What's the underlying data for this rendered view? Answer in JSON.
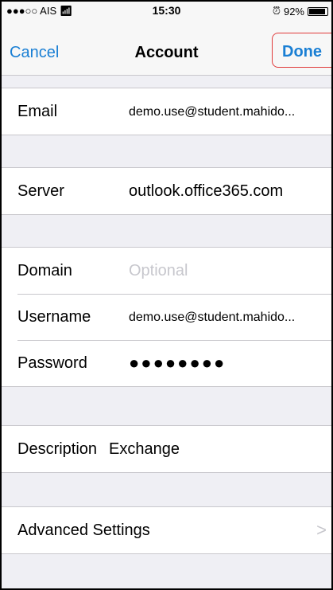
{
  "status_bar": {
    "carrier": "●●●○○ AIS",
    "wifi_icon": "wifi-icon",
    "time": "15:30",
    "alarm_icon": "alarm-icon",
    "battery_percent": "92%",
    "battery_level": 0.92
  },
  "nav": {
    "cancel_label": "Cancel",
    "title": "Account",
    "done_label": "Done"
  },
  "fields": {
    "email": {
      "label": "Email",
      "value": "demo.use@student.mahido..."
    },
    "server": {
      "label": "Server",
      "value": "outlook.office365.com"
    },
    "domain": {
      "label": "Domain",
      "placeholder": "Optional"
    },
    "username": {
      "label": "Username",
      "value": "demo.use@student.mahido..."
    },
    "password": {
      "label": "Password",
      "value": "●●●●●●●●"
    },
    "description": {
      "label": "Description",
      "value": "Exchange"
    },
    "advanced": {
      "label": "Advanced Settings",
      "chevron_icon": "chevron-right-icon",
      "chevron": ">"
    }
  }
}
